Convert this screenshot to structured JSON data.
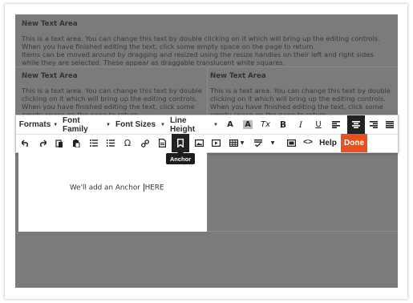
{
  "top_section": {
    "title": "New Text Area",
    "paragraph1": "This is a text area. You can change this text by double clicking on it which will bring up the editing controls. When you have finished editing the text, click some empty space on the page to return.",
    "paragraph2": "Items can be moved around by dragging and resized using the resize handles on their left and right sides while they are selected. These appear as draggable translucent white squares."
  },
  "left_section": {
    "title": "New Text Area",
    "paragraph": "This is a text area. You can change this text by double clicking on it which will bring up the editing controls. When you have finished editing the text, click some empty space on the page to return."
  },
  "right_section": {
    "title": "New Text Area",
    "paragraph": "This is a text area. You can change this text by double clicking on it which will bring up the editing controls. When you have finished editing the text, click some empty space on the page to return."
  },
  "toolbar": {
    "formats": "Formats",
    "font_family": "Font Family",
    "font_sizes": "Font Sizes",
    "line_height": "Line Height",
    "bold": "B",
    "italic": "I",
    "underline": "U",
    "clear_format": "Tx",
    "font_color": "A",
    "bg_color": "A",
    "help": "Help",
    "done": "Done",
    "omega": "Ω",
    "code": "<>",
    "accent_color": "#e8501e"
  },
  "tooltip": "Anchor",
  "editor": {
    "text_before": "We'll add an Anchor ",
    "text_after": "HERE"
  }
}
